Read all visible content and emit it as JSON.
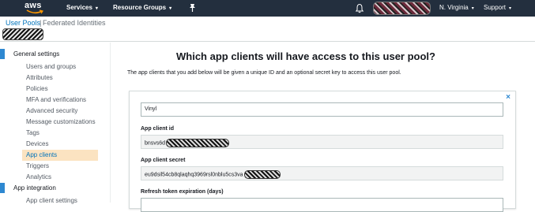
{
  "topbar": {
    "logo_text": "aws",
    "nav": {
      "services": "Services",
      "resource_groups": "Resource Groups",
      "region": "N. Virginia",
      "support": "Support"
    },
    "caret": "▾"
  },
  "subheader": {
    "tab_user_pools": "User Pools",
    "separator": "|",
    "tab_federated": "Federated Identities"
  },
  "sidebar": {
    "general_settings": "General settings",
    "items": [
      "Users and groups",
      "Attributes",
      "Policies",
      "MFA and verifications",
      "Advanced security",
      "Message customizations",
      "Tags",
      "Devices",
      "App clients",
      "Triggers",
      "Analytics"
    ],
    "active_item": "App clients",
    "app_integration": "App integration",
    "app_integration_items": [
      "App client settings"
    ]
  },
  "main": {
    "title": "Which app clients will have access to this user pool?",
    "description": "The app clients that you add below will be given a unique ID and an optional secret key to access this user pool.",
    "close_symbol": "×",
    "app_client_name": "Vinyl",
    "app_client_id_label": "App client id",
    "app_client_id_visible": "bnsvs6d",
    "app_client_secret_label": "App client secret",
    "app_client_secret_visible": "eu9dsil54cb8qlaqhq3969rsl0nblu5cs3va",
    "refresh_label": "Refresh token expiration (days)"
  },
  "colors": {
    "topbar_bg": "#232f3e",
    "link_blue": "#0073bb",
    "section_accent": "#2e88d1",
    "active_highlight": "#fbe3c1"
  },
  "icons": [
    "aws-logo-icon",
    "pin-icon",
    "bell-icon",
    "caret-down-icon",
    "close-icon"
  ]
}
